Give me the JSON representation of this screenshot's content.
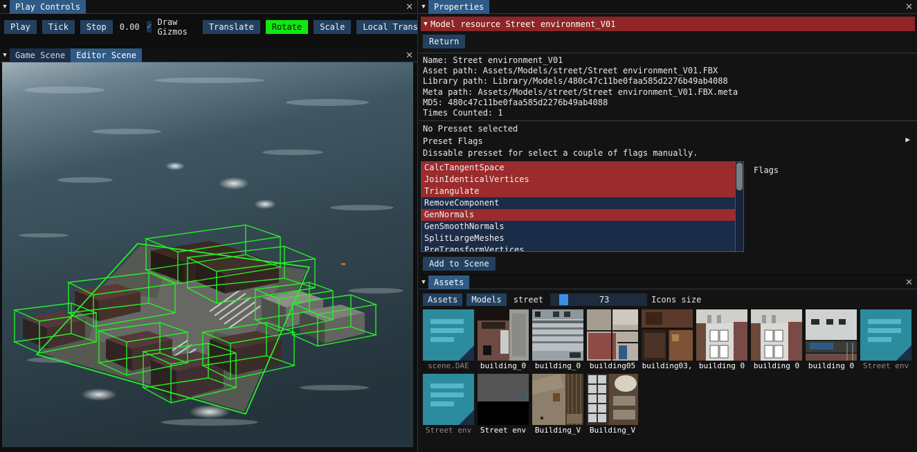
{
  "play_controls": {
    "panel_title": "Play Controls",
    "collapse_icon": "collapse-triangle-icon",
    "close_icon": "close-icon",
    "play_label": "Play",
    "tick_label": "Tick",
    "stop_label": "Stop",
    "time_value": "0.00",
    "draw_gizmos_label": "Draw Gizmos",
    "draw_gizmos_checked": true,
    "translate_label": "Translate",
    "rotate_label": "Rotate",
    "scale_label": "Scale",
    "transform_space_label": "Local Transfo",
    "active_gizmo_color": "#10e810"
  },
  "scene": {
    "collapse_icon": "collapse-triangle-icon",
    "close_icon": "close-icon",
    "tabs": [
      {
        "label": "Game Scene",
        "active": false
      },
      {
        "label": "Editor Scene",
        "active": true
      }
    ],
    "wireframe_color": "#27ef27"
  },
  "properties": {
    "panel_title": "Properties",
    "collapse_icon": "collapse-triangle-icon",
    "close_icon": "close-icon",
    "resource_header": "Model resource Street environment_V01",
    "resource_header_color": "#8f2526",
    "return_label": "Return",
    "meta_lines": [
      "Name: Street environment_V01",
      "Asset path: Assets/Models/street/Street environment_V01.FBX",
      "Library path: Library/Models/480c47c11be0faa585d2276b49ab4088",
      "Meta path: Assets/Models/street/Street environment_V01.FBX.meta",
      "MD5: 480c47c11be0faa585d2276b49ab4088",
      "Times Counted: 1"
    ],
    "preset_status": "No Presset selected",
    "preset_flags_label": "Preset Flags",
    "preset_arrow_icon": "play-arrow-icon",
    "preset_hint": "Dissable presset for select a couple of flags manually.",
    "flags_side_label": "Flags",
    "flags": [
      {
        "label": "CalcTangentSpace",
        "selected": true
      },
      {
        "label": "JoinIdenticalVertices",
        "selected": true
      },
      {
        "label": "Triangulate",
        "selected": true
      },
      {
        "label": "RemoveComponent",
        "selected": false
      },
      {
        "label": "GenNormals",
        "selected": true
      },
      {
        "label": "GenSmoothNormals",
        "selected": false
      },
      {
        "label": "SplitLargeMeshes",
        "selected": false
      },
      {
        "label": "PreTransformVertices",
        "selected": false
      }
    ],
    "add_to_scene_label": "Add to Scene"
  },
  "assets": {
    "panel_title": "Assets",
    "collapse_icon": "collapse-triangle-icon",
    "close_icon": "close-icon",
    "breadcrumb": [
      {
        "label": "Assets",
        "button": true
      },
      {
        "label": "Models",
        "button": true
      },
      {
        "label": "street",
        "button": false
      }
    ],
    "icon_size_value": "73",
    "icon_size_label": "Icons size",
    "items": [
      {
        "label": "scene.DAE",
        "kind": "document",
        "dim": true
      },
      {
        "label": "building_0",
        "kind": "texture",
        "dim": false,
        "c1": "#6d4a42",
        "c2": "#9a9a97",
        "c3": "#2a2622"
      },
      {
        "label": "building_0",
        "kind": "texture",
        "dim": false,
        "c1": "#b9bfc2",
        "c2": "#8d969b",
        "c3": "#5d6569"
      },
      {
        "label": "building05",
        "kind": "texture",
        "dim": false,
        "c1": "#b8b0a6",
        "c2": "#8e4a46",
        "c3": "#6d6a66"
      },
      {
        "label": "building03,",
        "kind": "texture",
        "dim": false,
        "c1": "#5b3a2c",
        "c2": "#7d5236",
        "c3": "#2e211a"
      },
      {
        "label": "building 0",
        "kind": "texture",
        "dim": false,
        "c1": "#d9d9d6",
        "c2": "#7a4a46",
        "c3": "#4a4a4a"
      },
      {
        "label": "building 0",
        "kind": "texture",
        "dim": false,
        "c1": "#d9d9d6",
        "c2": "#7a4a46",
        "c3": "#4a4a4a"
      },
      {
        "label": "building 0",
        "kind": "texture",
        "dim": false,
        "c1": "#cfd2d0",
        "c2": "#6a6f70",
        "c3": "#20211f"
      },
      {
        "label": "Street env",
        "kind": "document",
        "dim": true
      },
      {
        "label": "Street env",
        "kind": "document",
        "dim": true
      },
      {
        "label": "Street env",
        "kind": "texture",
        "dim": false,
        "c1": "#555555",
        "c2": "#5a5a5a",
        "c3": "#000000"
      },
      {
        "label": "Building_V",
        "kind": "texture",
        "dim": false,
        "c1": "#8d7f6b",
        "c2": "#4a3a2a",
        "c3": "#6b5a46"
      },
      {
        "label": "Building_V",
        "kind": "texture",
        "dim": false,
        "c1": "#c9cfd2",
        "c2": "#5a4636",
        "c3": "#8f8675"
      }
    ]
  }
}
